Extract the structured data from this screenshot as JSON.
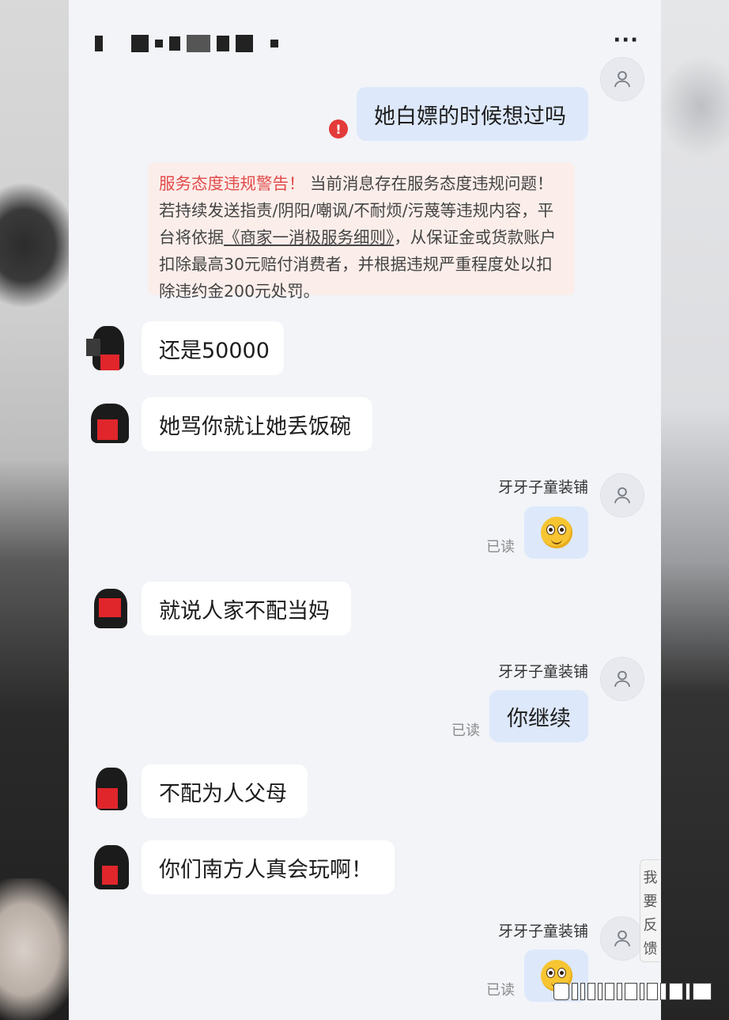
{
  "chat": {
    "out_msg_1": "她白嫖的时候想过吗",
    "warning": {
      "highlight": "服务态度违规警告！",
      "text_1": "当前消息存在服务态度违规问题！若持续发送指责/阴阳/嘲讽/不耐烦/污蔑等违规内容，平台将依据",
      "link": "《商家一消极服务细则》",
      "text_2": "，从保证金或货款账户扣除最高30元赔付消费者，并根据违规严重程度处以扣除违约金200元处罚。"
    },
    "in_msg_1": "还是50000",
    "in_msg_2": "她骂你就让她丢饭碗",
    "seller_name_1": "牙牙子童装铺",
    "read_1": "已读",
    "in_msg_3": "就说人家不配当妈",
    "seller_name_2": "牙牙子童装铺",
    "out_msg_2": "你继续",
    "read_2": "已读",
    "in_msg_4": "不配为人父母",
    "in_msg_5": "你们南方人真会玩啊！",
    "seller_name_3": "牙牙子童装铺",
    "read_3": "已读"
  },
  "header": {
    "more": "···"
  },
  "feedback": {
    "c1": "我",
    "c2": "要",
    "c3": "反",
    "c4": "馈"
  },
  "colors": {
    "out_bubble": "#dde8fb",
    "in_bubble": "#ffffff",
    "warning_bg": "#fbeeea",
    "warning_red": "#e24a4a"
  }
}
